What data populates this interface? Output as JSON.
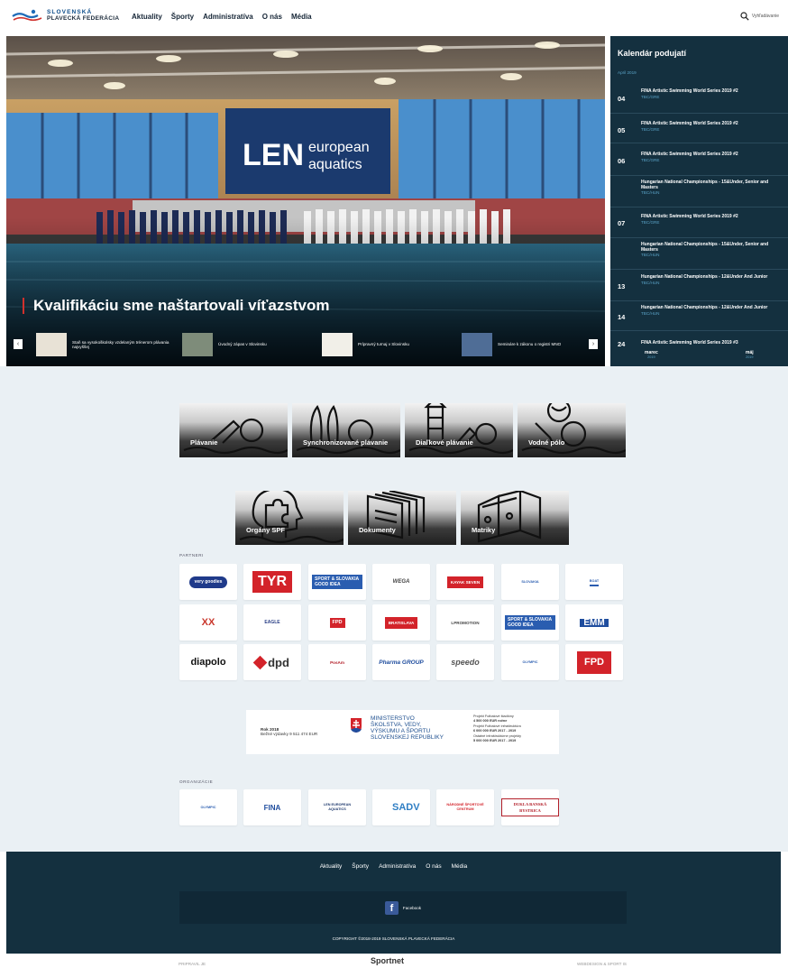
{
  "header": {
    "logo_line1": "SLOVENSKÁ",
    "logo_line2": "PLAVECKÁ FEDERÁCIA",
    "nav": [
      "Aktuality",
      "Športy",
      "Administratíva",
      "O nás",
      "Média"
    ],
    "search_label": "Vyhľadávanie"
  },
  "hero": {
    "title": "Kvalifikáciu sme naštartovali víťazstvom",
    "banner_text_1": "european",
    "banner_text_2": "aquatics",
    "thumbs": [
      "Staň sa vysokoškolsky vzdelaným trénerom plávania najvyššej",
      "Úvodný zápas v Slovinsku",
      "Prípravný turnaj v Slovinsku",
      "Semináre k zákonu o registri MNO"
    ],
    "prev": "‹",
    "next": "›"
  },
  "calendar": {
    "title": "Kalendár podujatí",
    "month": "April 2019",
    "events": [
      {
        "day": "04",
        "name": "FINA Artistic Swimming World Series 2019 #2",
        "loc": "TBC/GRE"
      },
      {
        "day": "05",
        "name": "FINA Artistic Swimming World Series 2019 #2",
        "loc": "TBC/GRE"
      },
      {
        "day": "06",
        "name": "FINA Artistic Swimming World Series 2019 #2",
        "loc": "TBC/GRE"
      },
      {
        "day": "",
        "name": "Hungarian National Championships - 15&Under, Senior and Masters",
        "loc": "TBC/HUN"
      },
      {
        "day": "07",
        "name": "FINA Artistic Swimming World Series 2019 #2",
        "loc": "TBC/GRE"
      },
      {
        "day": "",
        "name": "Hungarian National Championships - 15&Under, Senior and Masters",
        "loc": "TBC/HUN"
      },
      {
        "day": "13",
        "name": "Hungarian National Championships - 12&Under And Junior",
        "loc": "TBC/HUN"
      },
      {
        "day": "14",
        "name": "Hungarian National Championships - 12&Under And Junior",
        "loc": "TBC/HUN"
      },
      {
        "day": "24",
        "name": "FINA Artistic Swimming World Series 2019 #3",
        "loc": ""
      }
    ],
    "prev_month": "marec",
    "prev_year": "2019",
    "next_month": "máj",
    "next_year": "2019"
  },
  "sports": [
    {
      "label": "Plávanie",
      "icon": "swimmer-icon"
    },
    {
      "label": "Synchronizované plávanie",
      "icon": "synchro-icon"
    },
    {
      "label": "Diaľkové plávanie",
      "icon": "lighthouse-icon"
    },
    {
      "label": "Vodné pólo",
      "icon": "waterpolo-icon"
    },
    {
      "label": "Orgány SPF",
      "icon": "head-puzzle-icon"
    },
    {
      "label": "Dokumenty",
      "icon": "documents-icon"
    },
    {
      "label": "Matriky",
      "icon": "binders-icon"
    }
  ],
  "partners_label": "PARTNERI",
  "partners": [
    "very goodies",
    "TYR",
    "SPORT & SLOVAKIA GOOD IDEA",
    "WEGA",
    "KAYAK SEVEN",
    "SLOVAKIA",
    "BOAT",
    "XX",
    "EAGLE",
    "FPD",
    "BRATISLAVA",
    "LPROMOTION",
    "SPORT & SLOVAKIA GOOD IDEA",
    "EMM",
    "diapolo",
    "dpd",
    "PosAm",
    "Pharma GROUP",
    "speedo",
    "OLYMPIC",
    "FPD"
  ],
  "ministry": {
    "left_year": "Rok 2018",
    "left_line": "Bežné výdavky 9 511 474 EUR",
    "name_1": "MINISTERSTVO",
    "name_2": "ŠKOLSTVA, VEDY,",
    "name_3": "VÝSKUMU A ŠPORTU",
    "name_4": "SLOVENSKEJ REPUBLIKY",
    "r1a": "Projekt Futbalové štadióny",
    "r1b": "4 500 000 EUR ročne",
    "r2a": "Projekt Futbalové infraštruktúra",
    "r2b": "6 000 000 EUR 2017 - 2019",
    "r3a": "Ostatné infraštruktúrne projekty",
    "r3b": "5 000 000 EUR 2017 - 2019"
  },
  "org_label": "ORGANIZÁCIE",
  "orgs": [
    "OLYMPIC",
    "FINA",
    "LEN EUROPEAN AQUATICS",
    "SADV",
    "NÁRODNÉ ŠPORTOVÉ CENTRUM",
    "DUKLA BANSKÁ BYSTRICA"
  ],
  "footer": {
    "nav": [
      "Aktuality",
      "Športy",
      "Administratíva",
      "O nás",
      "Média"
    ],
    "facebook": "Facebook",
    "copyright": "COPYRIGHT ©2018-2019 SLOVENSKÁ PLAVECKÁ FEDERÁCIA"
  },
  "bottom": {
    "left": "PRIPRAVIL JE",
    "mid": "Sportnet",
    "right": "WEBDESIGN & SPORT IS"
  },
  "colors": {
    "navy": "#14303f",
    "accent_red": "#d0312d",
    "light_bg": "#eaf0f4"
  }
}
